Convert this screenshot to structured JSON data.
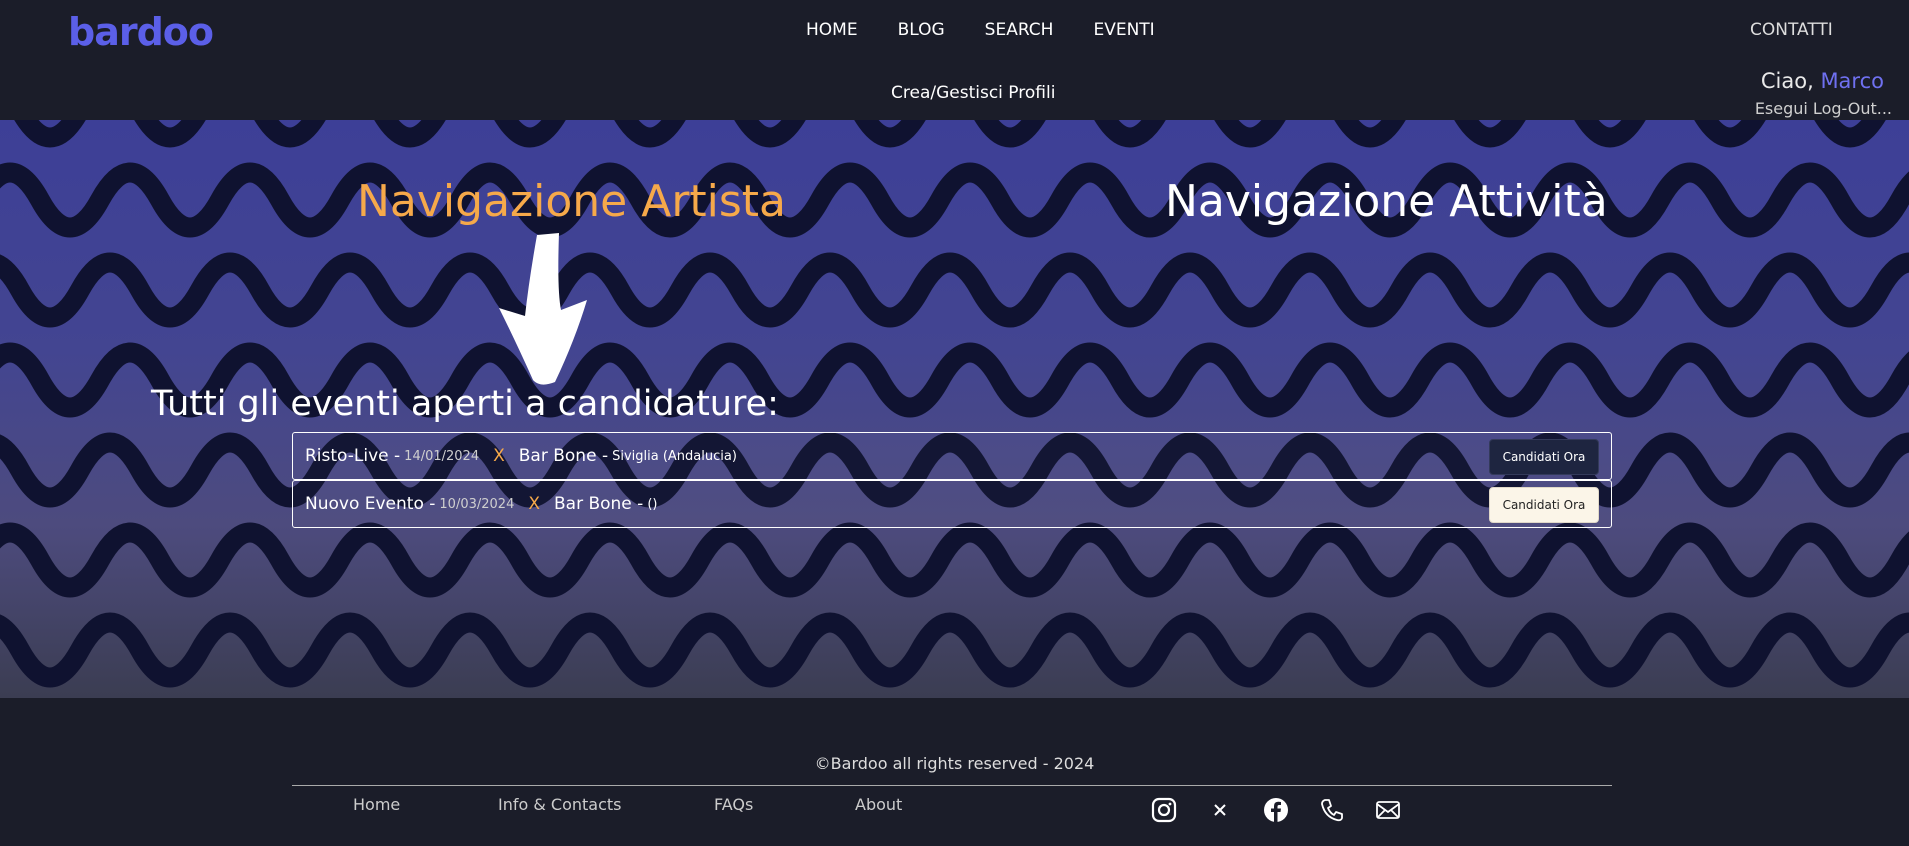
{
  "header": {
    "logo": "bardoo",
    "nav": [
      "HOME",
      "BLOG",
      "SEARCH",
      "EVENTI"
    ],
    "contatti": "CONTATTI",
    "crea_profili": "Crea/Gestisci Profili",
    "greeting": "Ciao,",
    "user_name": "Marco",
    "logout": "Esegui Log-Out..."
  },
  "hero": {
    "nav_artista": "Navigazione Artista",
    "nav_attivita": "Navigazione Attività",
    "events_title": "Tutti gli eventi aperti a candidature:"
  },
  "events": [
    {
      "name": "Risto-Live -",
      "date": "14/01/2024",
      "x": "X",
      "venue": "Bar Bone -",
      "location": "Siviglia (Andalucia)",
      "button": "Candidati Ora"
    },
    {
      "name": "Nuovo Evento -",
      "date": "10/03/2024",
      "x": "X",
      "venue": "Bar Bone -",
      "location": "()",
      "button": "Candidati Ora"
    }
  ],
  "footer": {
    "copyright": "©Bardoo all rights reserved - 2024",
    "links": [
      "Home",
      "Info & Contacts",
      "FAQs",
      "About"
    ],
    "socials": [
      "instagram-icon",
      "x-icon",
      "facebook-icon",
      "phone-icon",
      "mail-icon"
    ]
  },
  "colors": {
    "brand": "#5b5fe8",
    "accent_orange": "#f6a94a",
    "background": "#1b1d29",
    "hero_blue": "#3d3f97"
  }
}
